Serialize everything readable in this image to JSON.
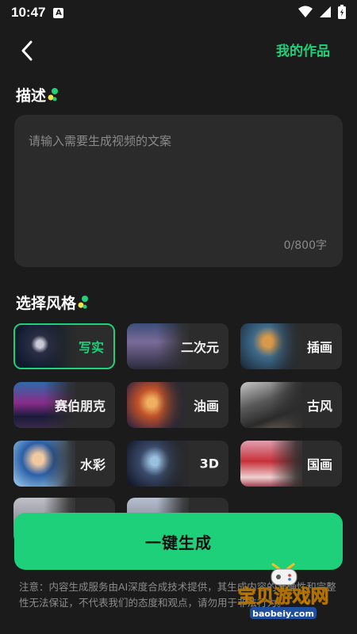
{
  "status": {
    "time": "10:47",
    "notification": "A"
  },
  "header": {
    "my_works": "我的作品"
  },
  "description": {
    "title": "描述",
    "placeholder": "请输入需要生成视频的文案",
    "counter": "0/800字"
  },
  "styles": {
    "title": "选择风格",
    "items": [
      {
        "label": "写实",
        "selected": true
      },
      {
        "label": "二次元"
      },
      {
        "label": "插画"
      },
      {
        "label": "赛伯朋克"
      },
      {
        "label": "油画"
      },
      {
        "label": "古风"
      },
      {
        "label": "水彩"
      },
      {
        "label": "3D"
      },
      {
        "label": "国画"
      }
    ]
  },
  "generate_button": {
    "label": "一键生成"
  },
  "notice": "注意：内容生成服务由AI深度合成技术提供，其生成内容的准确性和完整性无法保证，不代表我们的态度和观点，请勿用于非法行为。",
  "watermark": {
    "text": "宝贝游戏网",
    "url": "baobeiy.com"
  },
  "colors": {
    "accent": "#1fd07a",
    "background": "#1b1b1b",
    "card": "#2c2c2c"
  }
}
